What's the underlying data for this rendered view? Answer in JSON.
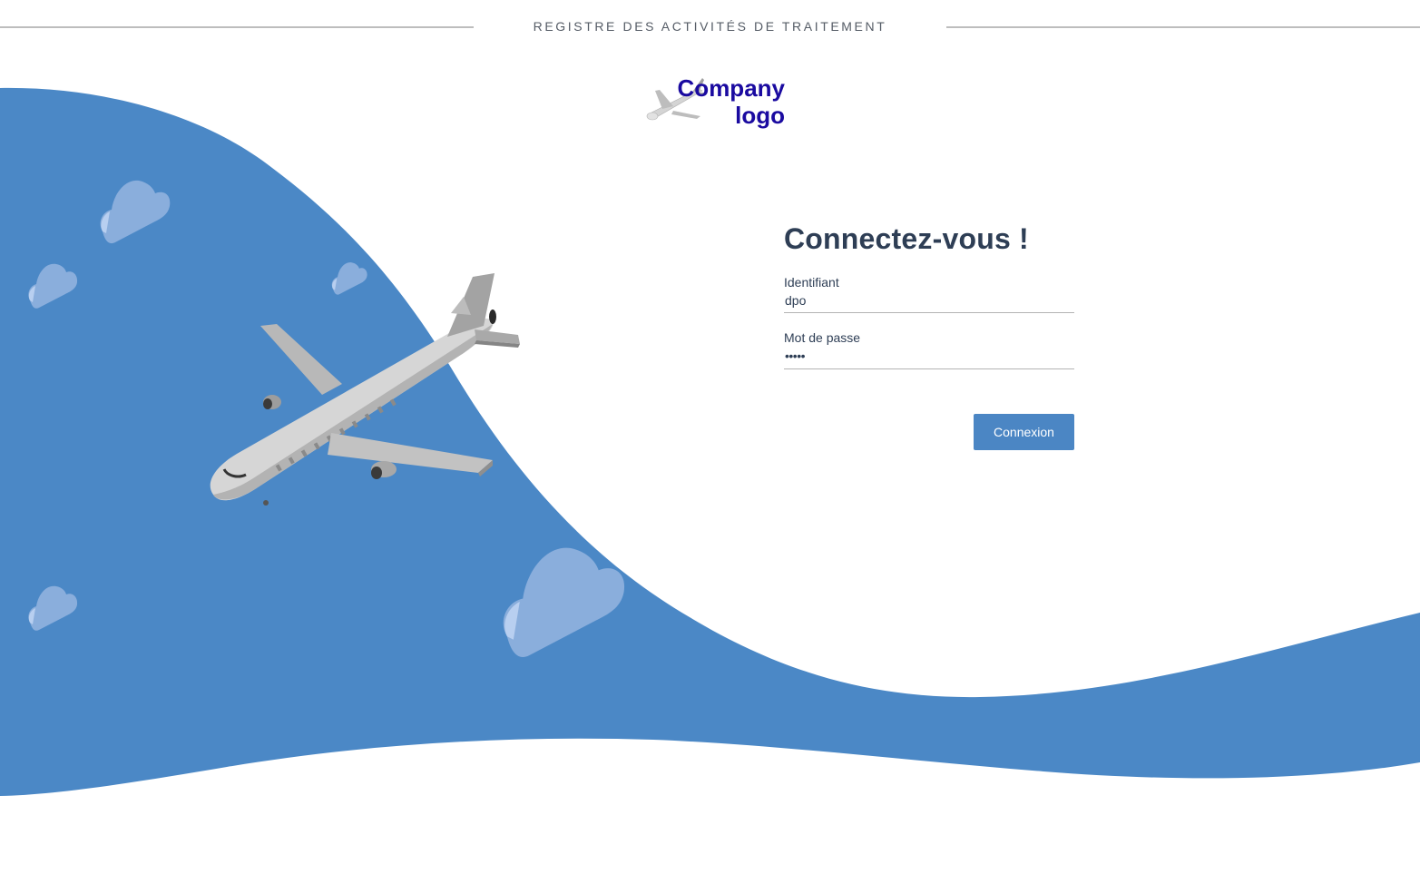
{
  "header": {
    "title": "REGISTRE DES ACTIVITÉS DE TRAITEMENT"
  },
  "logo": {
    "line1": "Company",
    "line2": "logo",
    "text_color": "#1a0aa0"
  },
  "login": {
    "title": "Connectez-vous !",
    "username_label": "Identifiant",
    "username_value": "dpo",
    "password_label": "Mot de passe",
    "password_value": "•••••",
    "submit_label": "Connexion"
  },
  "colors": {
    "wave": "#4b88c6",
    "cloud": "#8aaedc",
    "button": "#4b86c4",
    "text": "#2e3e55"
  },
  "icons": {
    "hero": "airplane-illustration",
    "logo": "airplane-logo-icon",
    "decor": "cloud-icon"
  }
}
